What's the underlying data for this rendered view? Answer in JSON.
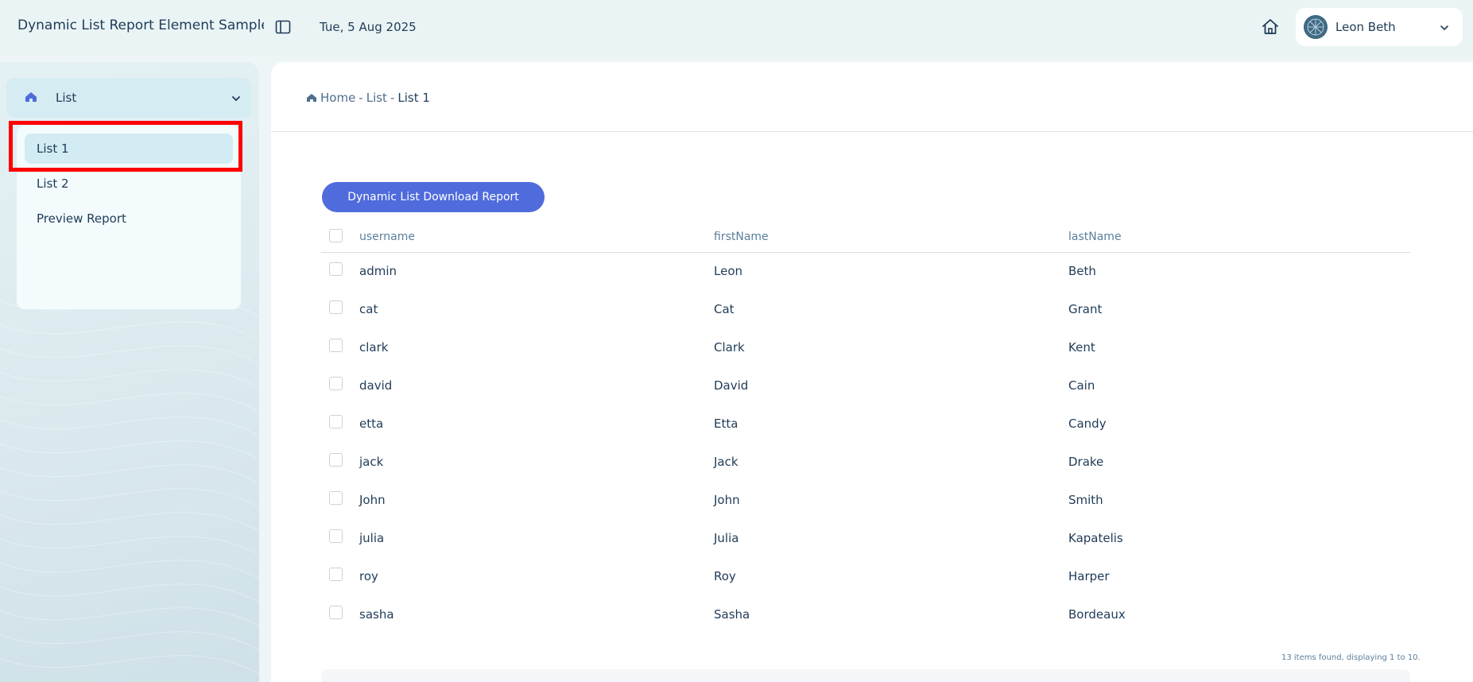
{
  "header": {
    "app_title": "Dynamic List Report Element Sample App",
    "date": "Tue, 5 Aug 2025",
    "user_name": "Leon Beth"
  },
  "sidebar": {
    "group_label": "List",
    "items": [
      {
        "label": "List 1",
        "active": true
      },
      {
        "label": "List 2",
        "active": false
      },
      {
        "label": "Preview Report",
        "active": false
      }
    ]
  },
  "breadcrumb": {
    "home": "Home",
    "sep": "-",
    "section": "List",
    "current": "List 1"
  },
  "main": {
    "download_button": "Dynamic List Download Report",
    "columns": [
      "username",
      "firstName",
      "lastName"
    ],
    "rows": [
      [
        "admin",
        "Leon",
        "Beth"
      ],
      [
        "cat",
        "Cat",
        "Grant"
      ],
      [
        "clark",
        "Clark",
        "Kent"
      ],
      [
        "david",
        "David",
        "Cain"
      ],
      [
        "etta",
        "Etta",
        "Candy"
      ],
      [
        "jack",
        "Jack",
        "Drake"
      ],
      [
        "John",
        "John",
        "Smith"
      ],
      [
        "julia",
        "Julia",
        "Kapatelis"
      ],
      [
        "roy",
        "Roy",
        "Harper"
      ],
      [
        "sasha",
        "Sasha",
        "Bordeaux"
      ]
    ],
    "footer": "13 items found, displaying 1 to 10."
  },
  "colors": {
    "accent": "#4f6bdc",
    "highlight": "#ff0000",
    "text": "#1f3b57"
  }
}
